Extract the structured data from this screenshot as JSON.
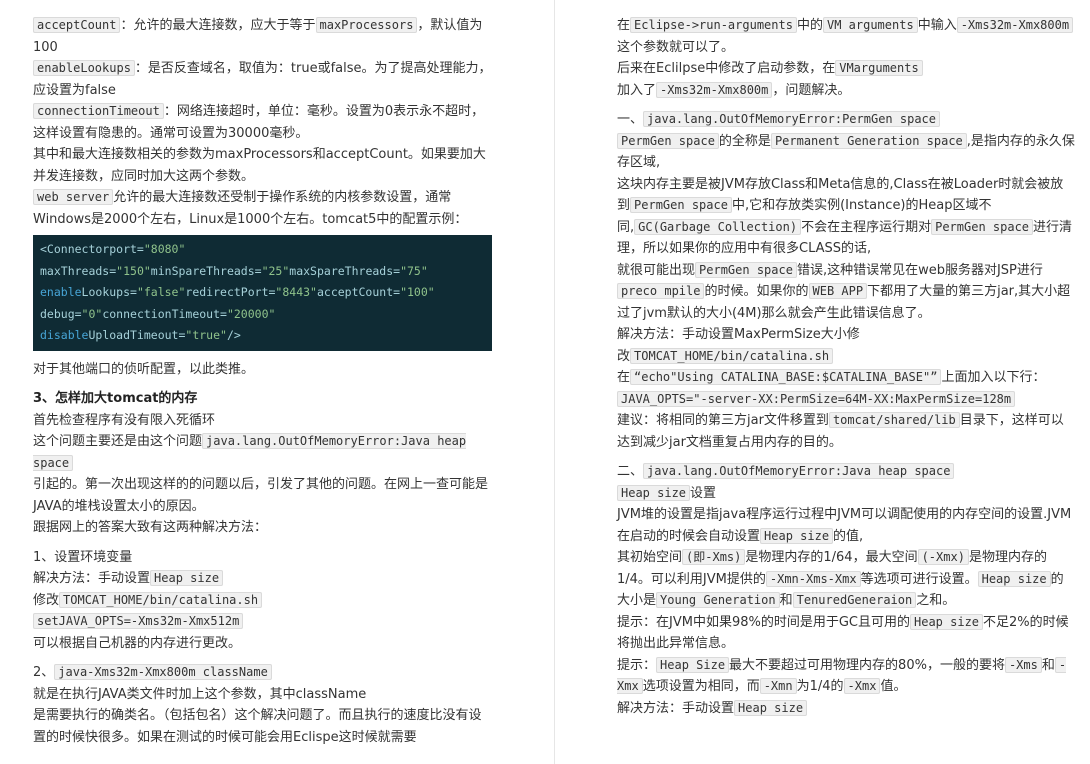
{
  "left": {
    "p1": {
      "c1": "acceptCount",
      "t1": "：允许的最大连接数，应大于等于",
      "c2": "maxProcessors",
      "t2": "，默认值为100"
    },
    "p2": {
      "c1": "enableLookups",
      "t1": "：是否反查域名，取值为：true或false。为了提高处理能力，应设置为false"
    },
    "p3": {
      "c1": "connectionTimeout",
      "t1": "：网络连接超时，单位：毫秒。设置为0表示永不超时，这样设置有隐患的。通常可设置为30000毫秒。"
    },
    "p4": "其中和最大连接数相关的参数为maxProcessors和acceptCount。如果要加大并发连接数，应同时加大这两个参数。",
    "p5": {
      "c1": "web server",
      "t1": "允许的最大连接数还受制于操作系统的内核参数设置，通常Windows是2000个左右，Linux是1000个左右。tomcat5中的配置示例："
    },
    "code": {
      "l1a": "<Connectorport=",
      "l1s": "\"8080\"",
      "l2a": "maxThreads=",
      "l2s1": "\"150\"",
      "l2b": "minSpareThreads=",
      "l2s2": "\"25\"",
      "l2c": "maxSpareThreads=",
      "l2s3": "\"75\"",
      "l3k": "enable",
      "l3a": "Lookups=",
      "l3s1": "\"false\"",
      "l3b": "redirectPort=",
      "l3s2": "\"8443\"",
      "l3c": "acceptCount=",
      "l3s3": "\"100\"",
      "l4a": "debug=",
      "l4s1": "\"0\"",
      "l4b": "connectionTimeout=",
      "l4s2": "\"20000\"",
      "l5k": "disable",
      "l5a": "UploadTimeout=",
      "l5s": "\"true\"",
      "l5b": "/>"
    },
    "p6": "对于其他端口的侦听配置，以此类推。",
    "h3": "3、怎样加大tomcat的内存",
    "p7": "首先检查程序有没有限入死循环",
    "p8": {
      "t1": "这个问题主要还是由这个问题",
      "c1": "java.lang.OutOfMemoryError:Java heap space"
    },
    "p9": "引起的。第一次出现这样的的问题以后，引发了其他的问题。在网上一查可能是JAVA的堆栈设置太小的原因。",
    "p10": "跟据网上的答案大致有这两种解决方法：",
    "p11": "1、设置环境变量",
    "p12": {
      "t1": "解决方法：手动设置",
      "c1": "Heap size"
    },
    "p13": {
      "t1": "修改",
      "c1": "TOMCAT_HOME/bin/catalina.sh"
    },
    "p14": {
      "c1": "setJAVA_OPTS=-Xms32m-Xmx512m"
    },
    "p15": "可以根据自己机器的内存进行更改。",
    "p16": {
      "t1": "2、",
      "c1": "java-Xms32m-Xmx800m className"
    },
    "p17": "就是在执行JAVA类文件时加上这个参数，其中className",
    "p18": "是需要执行的确类名。（包括包名）这个解决问题了。而且执行的速度比没有设置的时候快很多。如果在测试的时候可能会用Eclispe这时候就需要"
  },
  "right": {
    "r1": {
      "t1": "在",
      "c1": "Eclipse->run-arguments",
      "t2": "中的",
      "c2": "VM arguments",
      "t3": "中输入",
      "c3": "-Xms32m-Xmx800m",
      "t4": "这个参数就可以了。"
    },
    "r2": {
      "t1": "后来在Eclilpse中修改了启动参数，在",
      "c1": "VMarguments"
    },
    "r3": {
      "t1": "加入了",
      "c1": "-Xms32m-Xmx800m",
      "t2": "，问题解决。"
    },
    "r4": {
      "t1": "一、",
      "c1": "java.lang.OutOfMemoryError:PermGen space"
    },
    "r5": {
      "c1": "PermGen space",
      "t1": "的全称是",
      "c2": "Permanent Generation space",
      "t2": ",是指内存的永久保存区域,"
    },
    "r6": "这块内存主要是被JVM存放Class和Meta信息的,Class在被Loader时就会被放到",
    "r6b": {
      "c1": "PermGen space",
      "t1": "中,它和存放类实例(Instance)的Heap区域不同,",
      "c2": "GC(Garbage Collection)",
      "t2": "不会在主程序运行期对",
      "c3": "PermGen space",
      "t3": "进行清理，所以如果你的应用中有很多CLASS的话,"
    },
    "r7": {
      "t1": "就很可能出现",
      "c1": "PermGen space",
      "t2": "错误,这种错误常见在web服务器对JSP进行",
      "c2": "preco mpile",
      "t3": "的时候。如果你的",
      "c3": "WEB APP",
      "t4": "下都用了大量的第三方jar,其大小超过了jvm默认的大小(4M)那么就会产生此错误信息了。"
    },
    "r8": "解决方法：手动设置MaxPermSize大小修",
    "r9": {
      "t1": "改",
      "c1": "TOMCAT_HOME/bin/catalina.sh"
    },
    "r10": {
      "t1": "在",
      "c1": "“echo\"Using CATALINA_BASE:$CATALINA_BASE\"”",
      "t2": "上面加入以下行：",
      "c2": "JAVA_OPTS=\"-server-XX:PermSize=64M-XX:MaxPermSize=128m"
    },
    "r11": {
      "t1": "建议：将相同的第三方jar文件移置到",
      "c1": "tomcat/shared/lib",
      "t2": "目录下，这样可以达到减少jar文档重复占用内存的目的。"
    },
    "r12": {
      "t1": "二、",
      "c1": "java.lang.OutOfMemoryError:Java heap space"
    },
    "r13": {
      "c1": "Heap size",
      "t1": "设置"
    },
    "r14": {
      "t1": "JVM堆的设置是指java程序运行过程中JVM可以调配使用的内存空间的设置.JVM在启动的时候会自动设置",
      "c1": "Heap size",
      "t2": "的值,"
    },
    "r15": {
      "t1": "其初始空间",
      "c1": "(即-Xms)",
      "t2": "是物理内存的1/64，最大空间",
      "c2": "(-Xmx)",
      "t3": "是物理内存的1/4。可以利用JVM提供的",
      "c3": "-Xmn-Xms-Xmx",
      "t4": "等选项可进行设置。",
      "c4": "Heap size",
      "t5": "的大小是",
      "c5": "Young Generation",
      "t6": "和",
      "c6": "TenuredGeneraion",
      "t7": "之和。"
    },
    "r16": {
      "t1": "提示：在JVM中如果98%的时间是用于GC且可用的",
      "c1": "Heap size",
      "t2": "不足2%的时候将抛出此异常信息。"
    },
    "r17": {
      "t1": "提示：",
      "c1": "Heap Size",
      "t2": "最大不要超过可用物理内存的80%，一般的要将",
      "c2": "-Xms",
      "t3": "和",
      "c3": "-Xmx",
      "t4": "选项设置为相同，而",
      "c4": "-Xmn",
      "t5": "为1/4的",
      "c5": "-Xmx",
      "t6": "值。"
    },
    "r18": {
      "t1": "解决方法：手动设置",
      "c1": "Heap size"
    }
  }
}
